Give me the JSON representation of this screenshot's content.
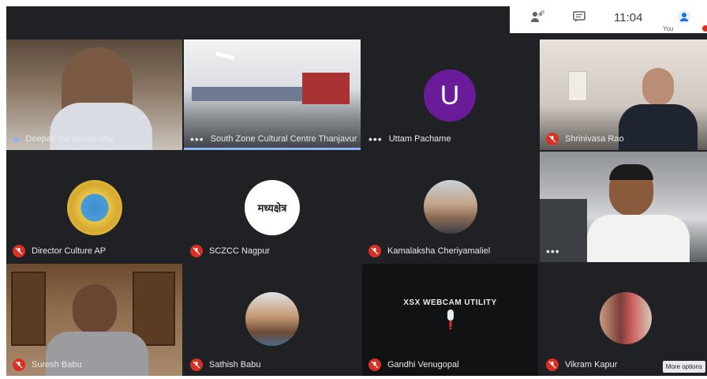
{
  "status_bar": {
    "time": "11:04",
    "you_label": "You"
  },
  "participants": [
    {
      "name": "Deepak Sahasrabudhe",
      "mic": "active",
      "kind": "video"
    },
    {
      "name": "South Zone Cultural Centre Thanjavur",
      "mic": "active",
      "kind": "video",
      "speaking": true
    },
    {
      "name": "Uttam Pachame",
      "mic": "active",
      "kind": "avatar",
      "initial": "U"
    },
    {
      "name": "Shrinivasa Rao",
      "mic": "muted",
      "kind": "video"
    },
    {
      "name": "Director Culture AP",
      "mic": "muted",
      "kind": "avatar-image"
    },
    {
      "name": "SCZCC Nagpur",
      "mic": "muted",
      "kind": "avatar-image",
      "logo_text": "मध्यक्षेत्र"
    },
    {
      "name": "Kamalaksha Cheriyamaliel",
      "mic": "muted",
      "kind": "avatar-image"
    },
    {
      "name": "",
      "mic": "active",
      "kind": "video"
    },
    {
      "name": "Suresh Babu",
      "mic": "muted",
      "kind": "video"
    },
    {
      "name": "Sathish Babu",
      "mic": "muted",
      "kind": "avatar-image"
    },
    {
      "name": "Gandhi Venugopal",
      "mic": "muted",
      "kind": "webcam-placeholder",
      "placeholder_text": "XSX WEBCAM UTILITY"
    },
    {
      "name": "Vikram Kapur",
      "mic": "muted",
      "kind": "avatar-image"
    }
  ],
  "more_options_label": "More options",
  "colors": {
    "muted": "#d93025",
    "speaking": "#8ab4f8",
    "tile_bg": "#202124"
  }
}
